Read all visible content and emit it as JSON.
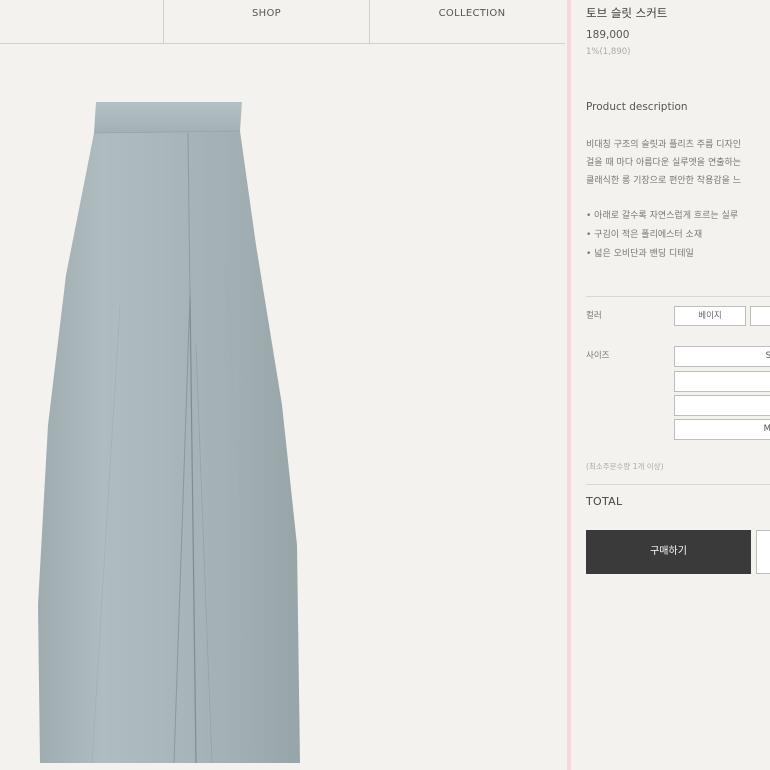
{
  "nav": {
    "shop_label": "SHOP",
    "collection_label": "COLLECTION"
  },
  "product": {
    "name": "토브 슬릿 스커트",
    "price": "189,000",
    "points": "1%(1,890)"
  },
  "description": {
    "title": "Product description",
    "lines": [
      "비대칭 구조의 슬릿과 플리츠 주름 디자인",
      "걸을 때 마다 아름다운 실루엣을 연출하는",
      "클래식한 롱 기장으로 편안한 착용감을 느"
    ],
    "bullets": [
      "• 아래로 갈수록 자연스럽게 흐르는 실루",
      "• 구김이 적은 폴리에스터 소재",
      "• 넓은 오비단과 밴딩 디테일"
    ]
  },
  "options": {
    "color_label": "컬러",
    "color_values": [
      "베이지",
      ""
    ],
    "size_label": "사이즈",
    "size_values": [
      "S",
      "",
      "",
      "M"
    ]
  },
  "min_qty_text": "(최소주문수량 1개 이상)",
  "total_label": "TOTAL",
  "buy_label": "구매하기",
  "colors": {
    "background": "#f3f2ee",
    "skirt": "#aab8bc",
    "buy_button": "#3a3a3a",
    "divider_accent": "#f6d8d8"
  }
}
